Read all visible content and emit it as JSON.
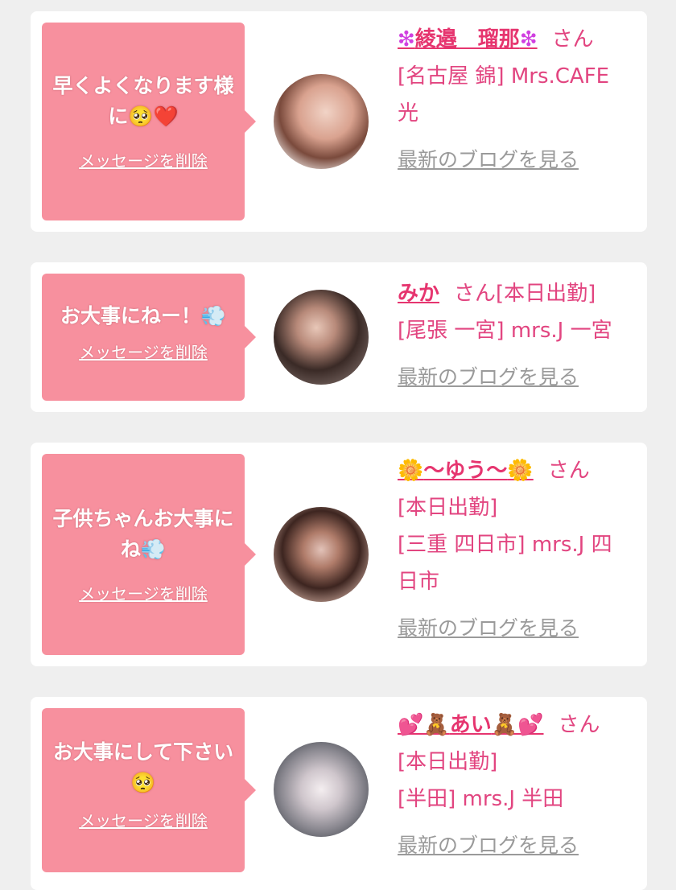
{
  "items": [
    {
      "message": "早くよくなります様に🥺❤️",
      "delete_label": "メッセージを削除",
      "name_deco_left": "❇",
      "name": "綾邉　瑠那",
      "name_deco_right": "❇",
      "san": "さん",
      "lines": [
        "[名古屋 錦] Mrs.CAFE",
        "光"
      ],
      "blog_label": "最新のブログを見る"
    },
    {
      "message": "お大事にねー！💨",
      "delete_label": "メッセージを削除",
      "name_deco_left": "",
      "name": "みか",
      "name_deco_right": "",
      "san": "さん[本日出勤]",
      "lines": [
        "[尾張 一宮] mrs.J 一宮"
      ],
      "blog_label": "最新のブログを見る"
    },
    {
      "message": "子供ちゃんお大事にね💨",
      "delete_label": "メッセージを削除",
      "name_deco_left": "🌼",
      "name": "〜ゆう〜",
      "name_deco_right": "🌼",
      "san": "さん",
      "lines": [
        "[本日出勤]",
        "[三重 四日市] mrs.J 四",
        "日市"
      ],
      "blog_label": "最新のブログを見る"
    },
    {
      "message": "お大事にして下さい🥺",
      "delete_label": "メッセージを削除",
      "name_deco_left": "💕🧸",
      "name": "あい",
      "name_deco_right": "🧸💕",
      "san": "さん",
      "lines": [
        "[本日出勤]",
        "[半田] mrs.J 半田"
      ],
      "blog_label": "最新のブログを見る"
    }
  ]
}
